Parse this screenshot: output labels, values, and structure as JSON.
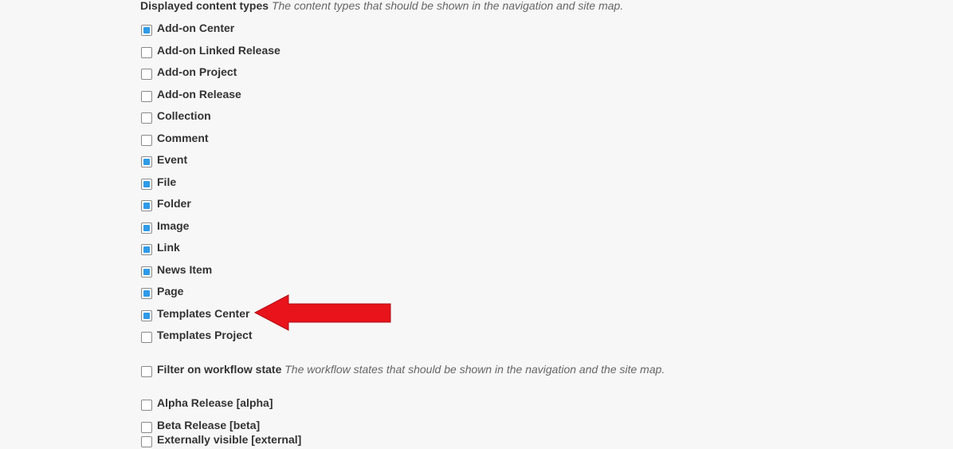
{
  "displayed_types": {
    "label": "Displayed content types",
    "help": "The content types that should be shown in the navigation and site map.",
    "items": [
      {
        "label": "Add-on Center",
        "checked": true
      },
      {
        "label": "Add-on Linked Release",
        "checked": false
      },
      {
        "label": "Add-on Project",
        "checked": false
      },
      {
        "label": "Add-on Release",
        "checked": false
      },
      {
        "label": "Collection",
        "checked": false
      },
      {
        "label": "Comment",
        "checked": false
      },
      {
        "label": "Event",
        "checked": true
      },
      {
        "label": "File",
        "checked": true
      },
      {
        "label": "Folder",
        "checked": true
      },
      {
        "label": "Image",
        "checked": true
      },
      {
        "label": "Link",
        "checked": true
      },
      {
        "label": "News Item",
        "checked": true
      },
      {
        "label": "Page",
        "checked": true
      },
      {
        "label": "Templates Center",
        "checked": true
      },
      {
        "label": "Templates Project",
        "checked": false
      }
    ]
  },
  "workflow_filter": {
    "label": "Filter on workflow state",
    "help": "The workflow states that should be shown in the navigation and the site map.",
    "checked": false
  },
  "workflow_states": {
    "items": [
      {
        "label": "Alpha Release [alpha]",
        "checked": false
      },
      {
        "label": "Beta Release [beta]",
        "checked": false
      },
      {
        "label": "Externally visible [external]",
        "checked": false
      }
    ]
  },
  "colors": {
    "background": "#f7f7f7",
    "checkbox_fill": "#2f9be8",
    "arrow": "#e8131b"
  },
  "annotation": {
    "icon": "red-arrow-left-icon"
  }
}
